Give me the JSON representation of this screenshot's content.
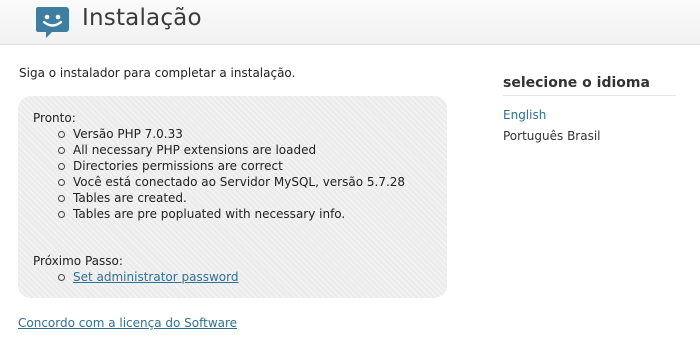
{
  "header": {
    "title": "Instalação",
    "logo_icon": "smiley-speech-bubble-icon",
    "logo_color": "#3f7ea3"
  },
  "intro": "Siga o instalador para completar a instalação.",
  "status": {
    "ready_label": "Pronto:",
    "checks": [
      "Versão PHP 7.0.33",
      "All necessary PHP extensions are loaded",
      "Directories permissions are correct",
      "Você está conectado ao Servidor MySQL, versão 5.7.28",
      "Tables are created.",
      "Tables are pre popluated with necessary info."
    ],
    "next_label": "Próximo Passo:",
    "next_link": "Set administrator password"
  },
  "license_link": "Concordo com a licença do Software",
  "language": {
    "title": "selecione o idioma",
    "options": [
      "English",
      "Português Brasil"
    ],
    "selected": "English"
  },
  "colors": {
    "link": "#2f6f96",
    "panel_bg": "#ececec"
  }
}
